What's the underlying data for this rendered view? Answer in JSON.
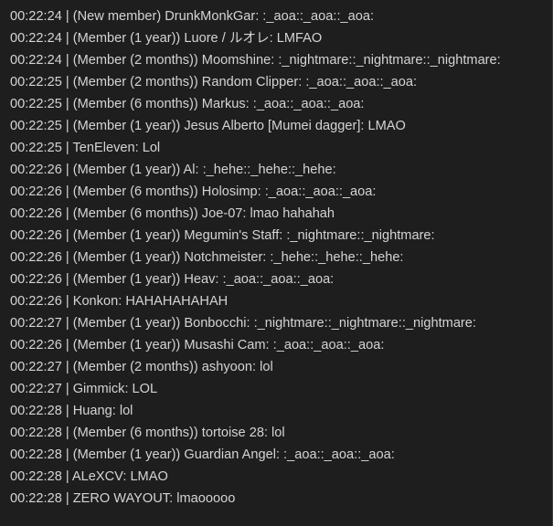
{
  "chat": {
    "lines": [
      "00:22:24 | (New member) DrunkMonkGar: :_aoa::_aoa::_aoa:",
      "00:22:24 | (Member (1 year)) Luore / ルオレ: LMFAO",
      "00:22:24 | (Member (2 months)) Moomshine: :_nightmare::_nightmare::_nightmare:",
      "00:22:25 | (Member (2 months)) Random Clipper: :_aoa::_aoa::_aoa:",
      "00:22:25 | (Member (6 months)) Markus: :_aoa::_aoa::_aoa:",
      "00:22:25 | (Member (1 year)) Jesus Alberto [Mumei dagger]: LMAO",
      "00:22:25 | TenEleven: Lol",
      "00:22:26 | (Member (1 year)) Al: :_hehe::_hehe::_hehe:",
      "00:22:26 | (Member (6 months)) Holosimp: :_aoa::_aoa::_aoa:",
      "00:22:26 | (Member (6 months)) Joe-07: lmao hahahah",
      "00:22:26 | (Member (1 year)) Megumin's Staff: :_nightmare::_nightmare:",
      "00:22:26 | (Member (1 year)) Notchmeister: :_hehe::_hehe::_hehe:",
      "00:22:26 | (Member (1 year)) Heav: :_aoa::_aoa::_aoa:",
      "00:22:26 | Konkon: HAHAHAHAHAH",
      "00:22:27 | (Member (1 year)) Bonbocchi: :_nightmare::_nightmare::_nightmare:",
      "00:22:26 | (Member (1 year)) Musashi Cam: :_aoa::_aoa::_aoa:",
      "00:22:27 | (Member (2 months)) ashyoon: lol",
      "00:22:27 | Gimmick: LOL",
      "00:22:28 | Huang: lol",
      "00:22:28 | (Member (6 months)) tortoise 28: lol",
      "00:22:28 | (Member (1 year)) Guardian Angel: :_aoa::_aoa::_aoa:",
      "00:22:28 | ALeXCV: LMAO",
      "00:22:28 | ZERO WAYOUT: lmaooooo"
    ]
  },
  "colors": {
    "background": "#1e1e1e",
    "text": "#d4d4d4"
  }
}
